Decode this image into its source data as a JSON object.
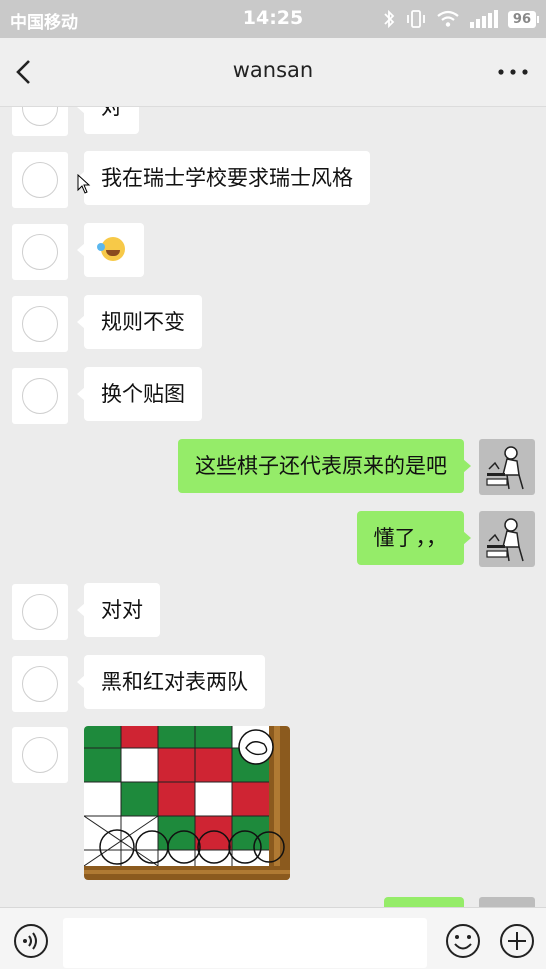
{
  "status_bar": {
    "carrier": "中国移动",
    "time": "14:25",
    "battery": "96"
  },
  "nav": {
    "title": "wansan"
  },
  "messages": [
    {
      "side": "left",
      "text": "对"
    },
    {
      "side": "left",
      "text": "我在瑞士学校要求瑞士风格"
    },
    {
      "side": "left",
      "emoji": "laughing-crying-emoji"
    },
    {
      "side": "left",
      "text": "规则不变"
    },
    {
      "side": "left",
      "text": "换个贴图"
    },
    {
      "side": "right",
      "text": "这些棋子还代表原来的是吧"
    },
    {
      "side": "right",
      "text": "懂了，，"
    },
    {
      "side": "left",
      "text": "对对"
    },
    {
      "side": "left",
      "text": "黑和红对表两队"
    },
    {
      "side": "left",
      "image": "chess-board-sticker-image"
    },
    {
      "side": "right",
      "text": ""
    }
  ],
  "colors": {
    "self_bubble": "#95ec69",
    "other_bubble": "#ffffff",
    "background": "#ececec",
    "board_green": "#1e8a3c",
    "board_red": "#cf2433"
  },
  "input": {
    "placeholder": ""
  }
}
